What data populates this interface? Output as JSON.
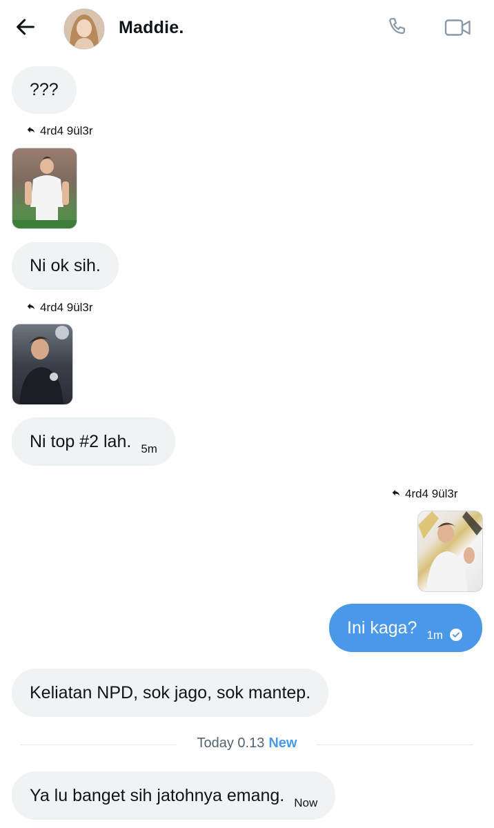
{
  "header": {
    "contact_name": "Maddie.",
    "back_icon": "arrow-left-icon",
    "call_icon": "phone-icon",
    "video_icon": "video-camera-icon"
  },
  "messages": [
    {
      "type": "text",
      "direction": "in",
      "text": "???"
    },
    {
      "type": "quote",
      "direction": "in",
      "label": "4rd4 9ül3r"
    },
    {
      "type": "image",
      "direction": "in",
      "alt": "player photo"
    },
    {
      "type": "text",
      "direction": "in",
      "text": "Ni ok sih."
    },
    {
      "type": "quote",
      "direction": "in",
      "label": "4rd4 9ül3r"
    },
    {
      "type": "image",
      "direction": "in",
      "alt": "player photo"
    },
    {
      "type": "text",
      "direction": "in",
      "text": "Ni top #2 lah.",
      "time": "5m"
    },
    {
      "type": "quote",
      "direction": "out",
      "label": "4rd4 9ül3r"
    },
    {
      "type": "image",
      "direction": "out",
      "alt": "player photo"
    },
    {
      "type": "text",
      "direction": "out",
      "text": "Ini kaga?",
      "time": "1m",
      "status": "read"
    },
    {
      "type": "text",
      "direction": "in",
      "text": "Keliatan NPD, sok jago, sok mantep."
    },
    {
      "type": "text",
      "direction": "in",
      "text": "Ya lu banget sih jatohnya emang.",
      "time": "Now"
    }
  ],
  "divider": {
    "date": "Today 0.13",
    "new_label": "New"
  },
  "colors": {
    "accent": "#4a99e9",
    "bubble_in": "#eff3f4",
    "text": "#0f1419"
  }
}
